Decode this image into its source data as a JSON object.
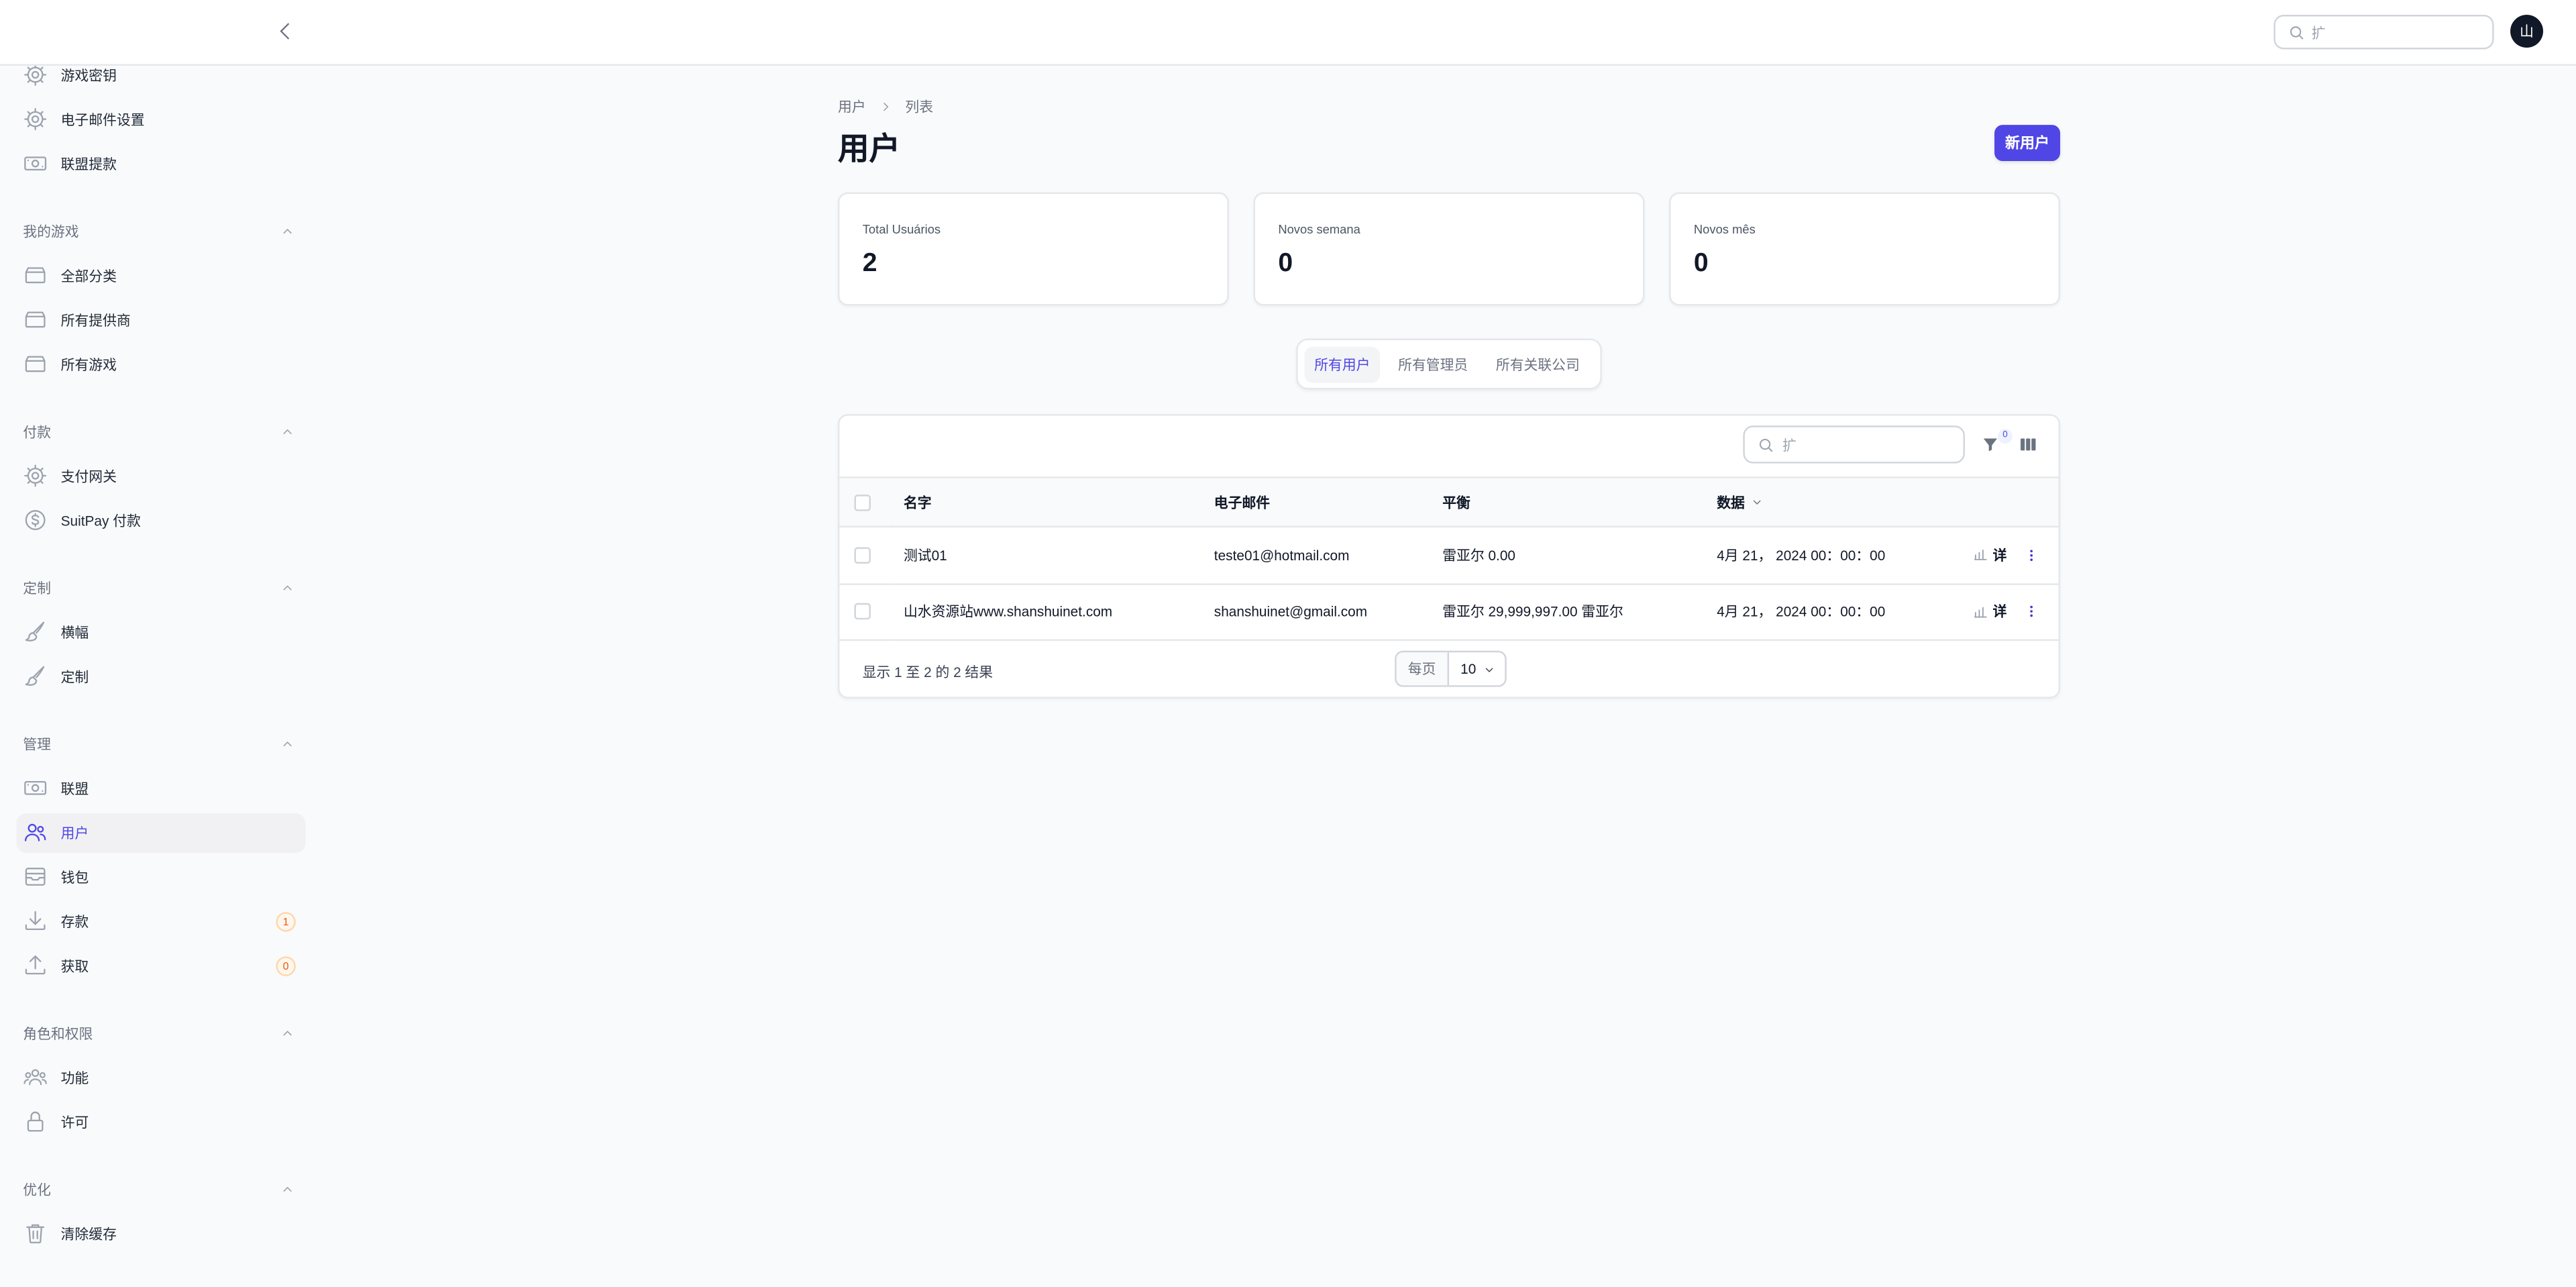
{
  "topbar": {
    "search_placeholder": "扩",
    "avatar_initial": "山"
  },
  "sidebar": {
    "sections": [
      {
        "title": "",
        "items": [
          {
            "label": "游戏密钥",
            "icon": "cog-icon"
          },
          {
            "label": "电子邮件设置",
            "icon": "cog-icon"
          },
          {
            "label": "联盟提款",
            "icon": "banknotes-icon"
          }
        ]
      },
      {
        "title": "我的游戏",
        "items": [
          {
            "label": "全部分类",
            "icon": "archive-box-icon"
          },
          {
            "label": "所有提供商",
            "icon": "archive-box-icon"
          },
          {
            "label": "所有游戏",
            "icon": "archive-box-icon"
          }
        ]
      },
      {
        "title": "付款",
        "items": [
          {
            "label": "支付网关",
            "icon": "cog-icon"
          },
          {
            "label": "SuitPay 付款",
            "icon": "currency-dollar-icon"
          }
        ]
      },
      {
        "title": "定制",
        "items": [
          {
            "label": "横幅",
            "icon": "paint-brush-icon"
          },
          {
            "label": "定制",
            "icon": "paint-brush-icon"
          }
        ]
      },
      {
        "title": "管理",
        "items": [
          {
            "label": "联盟",
            "icon": "banknotes-icon"
          },
          {
            "label": "用户",
            "icon": "users-icon",
            "active": true
          },
          {
            "label": "钱包",
            "icon": "wallet-icon"
          },
          {
            "label": "存款",
            "icon": "download-icon",
            "badge": "1"
          },
          {
            "label": "获取",
            "icon": "upload-icon",
            "badge": "0"
          }
        ]
      },
      {
        "title": "角色和权限",
        "items": [
          {
            "label": "功能",
            "icon": "user-group-icon"
          },
          {
            "label": "许可",
            "icon": "lock-icon"
          }
        ]
      },
      {
        "title": "优化",
        "items": [
          {
            "label": "清除缓存",
            "icon": "trash-icon"
          }
        ]
      }
    ]
  },
  "breadcrumb": [
    "用户",
    "列表"
  ],
  "page": {
    "title": "用户",
    "new_button": "新用户"
  },
  "stats": [
    {
      "label": "Total Usuários",
      "value": "2"
    },
    {
      "label": "Novos semana",
      "value": "0"
    },
    {
      "label": "Novos mês",
      "value": "0"
    }
  ],
  "tabs": [
    {
      "label": "所有用户",
      "active": true
    },
    {
      "label": "所有管理员"
    },
    {
      "label": "所有关联公司"
    }
  ],
  "table": {
    "search_placeholder": "扩",
    "filter_count": "0",
    "columns": [
      "名字",
      "电子邮件",
      "平衡",
      "数据"
    ],
    "rows": [
      {
        "name": "测试01",
        "email": "teste01@hotmail.com",
        "balance": "雷亚尔 0.00",
        "date": "4月 21， 2024 00：00：00",
        "action": "详"
      },
      {
        "name": "山水资源站www.shanshuinet.com",
        "email": "shanshuinet@gmail.com",
        "balance": "雷亚尔 29,999,997.00 雷亚尔",
        "date": "4月 21， 2024 00：00：00",
        "action": "详"
      }
    ],
    "footer": {
      "summary": "显示 1 至 2 的 2 结果",
      "per_page_label": "每页",
      "per_page_value": "10"
    }
  },
  "colors": {
    "accent": "#4f46e5",
    "badge_bg": "#fff7ed",
    "badge_text": "#ea580c",
    "background": "#f9fafb"
  }
}
